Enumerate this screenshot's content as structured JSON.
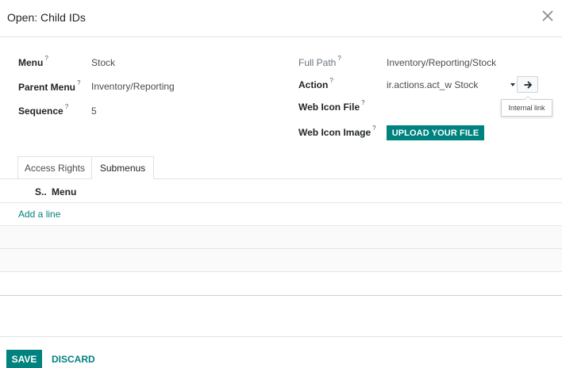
{
  "modal": {
    "title": "Open: Child IDs"
  },
  "form": {
    "menu_label": "Menu",
    "menu_value": "Stock",
    "parent_menu_label": "Parent Menu",
    "parent_menu_value": "Inventory/Reporting",
    "sequence_label": "Sequence",
    "sequence_value": "5",
    "full_path_label": "Full Path",
    "full_path_value": "Inventory/Reporting/Stock",
    "action_label": "Action",
    "action_value": "ir.actions.act_w Stock",
    "web_icon_file_label": "Web Icon File",
    "web_icon_image_label": "Web Icon Image",
    "upload_label": "UPLOAD YOUR FILE",
    "help_mark": "?",
    "tooltip": "Internal link"
  },
  "tabs": [
    {
      "label": "Access Rights",
      "active": false
    },
    {
      "label": "Submenus",
      "active": true
    }
  ],
  "table": {
    "columns": [
      "S..",
      "Menu"
    ],
    "add_line": "Add a line"
  },
  "footer": {
    "save": "SAVE",
    "discard": "DISCARD"
  },
  "colors": {
    "primary": "#00827f"
  }
}
